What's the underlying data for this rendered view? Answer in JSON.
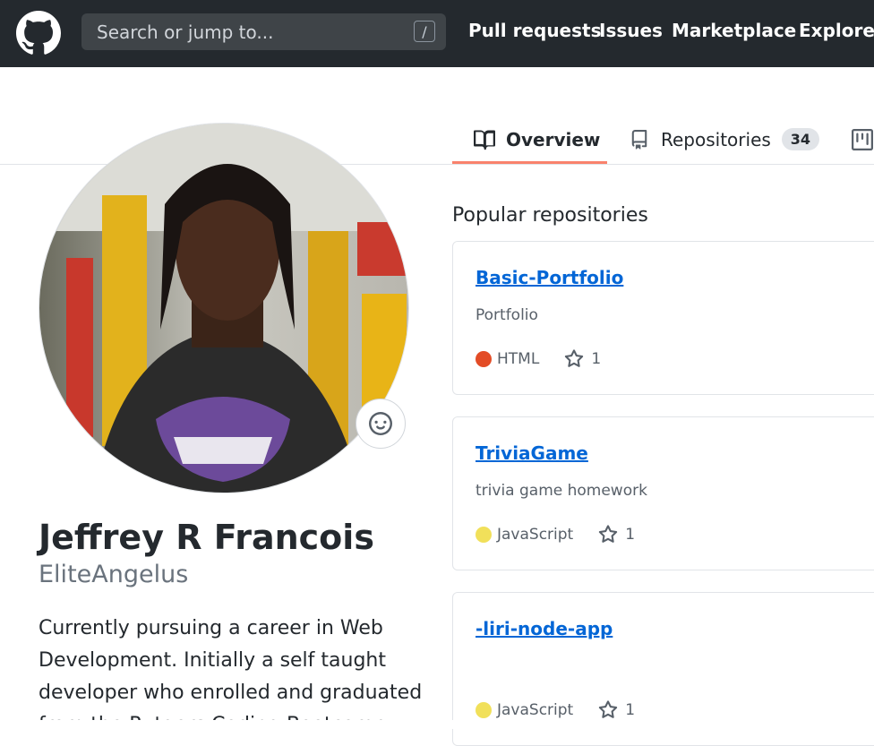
{
  "header": {
    "search_placeholder": "Search or jump to...",
    "search_shortcut": "/",
    "nav": [
      "Pull requests",
      "Issues",
      "Marketplace",
      "Explore"
    ]
  },
  "tabs": {
    "overview": "Overview",
    "repositories": "Repositories",
    "repositories_count": "34"
  },
  "profile": {
    "full_name": "Jeffrey R Francois",
    "username": "EliteAngelus",
    "bio": "Currently pursuing a career in Web Development. Initially a self taught developer who enrolled and graduated from the Rutgers Coding Bootcamp"
  },
  "popular": {
    "title": "Popular repositories",
    "repos": [
      {
        "name": "Basic-Portfolio",
        "description": "Portfolio",
        "language": "HTML",
        "lang_color": "#e34c26",
        "stars": "1"
      },
      {
        "name": "TriviaGame",
        "description": "trivia game homework",
        "language": "JavaScript",
        "lang_color": "#f1e05a",
        "stars": "1"
      },
      {
        "name": "-liri-node-app",
        "description": "",
        "language": "JavaScript",
        "lang_color": "#f1e05a",
        "stars": "1"
      }
    ]
  },
  "colors": {
    "header_bg": "#24292e",
    "link": "#0366d6",
    "tab_underline": "#f9826c"
  }
}
